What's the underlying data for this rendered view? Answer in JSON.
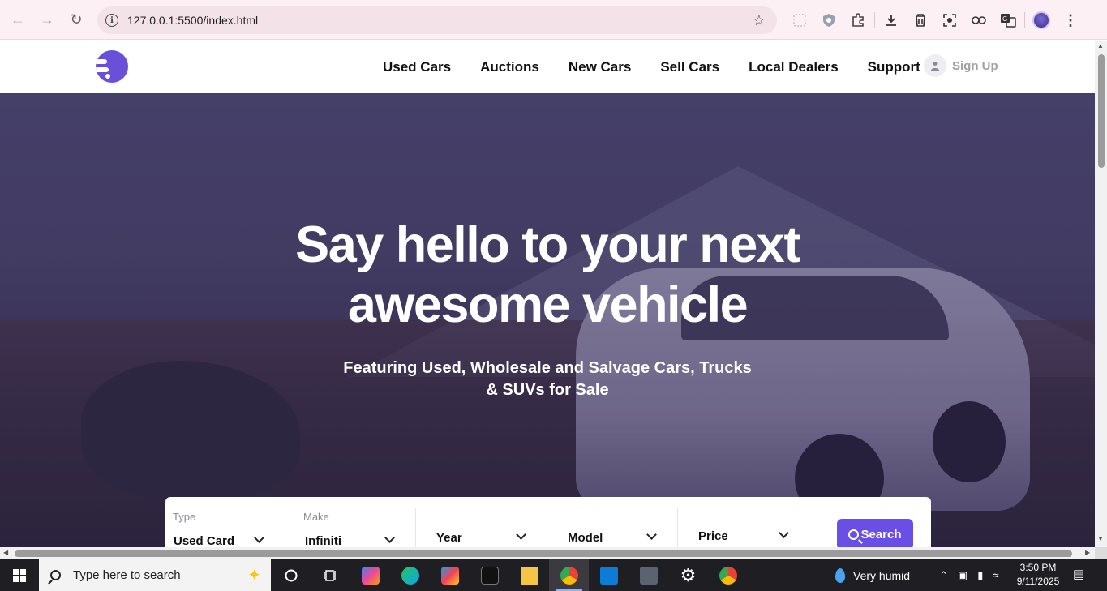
{
  "browser": {
    "url": "127.0.0.1:5500/index.html"
  },
  "site": {
    "nav": [
      "Used Cars",
      "Auctions",
      "New Cars",
      "Sell Cars",
      "Local Dealers",
      "Support"
    ],
    "signup_label": "Sign Up"
  },
  "hero": {
    "title_line1": "Say hello to your next",
    "title_line2": "awesome vehicle",
    "subtitle_line1": "Featuring Used, Wholesale and Salvage Cars, Trucks",
    "subtitle_line2": "& SUVs for Sale"
  },
  "search": {
    "type_label": "Type",
    "type_value": "Used Card",
    "make_label": "Make",
    "make_value": "Infiniti",
    "year_value": "Year",
    "model_value": "Model",
    "price_value": "Price",
    "button_label": "Search"
  },
  "taskbar": {
    "search_placeholder": "Type here to search",
    "weather": "Very humid",
    "time": "3:50 PM",
    "date": "9/11/2025"
  },
  "colors": {
    "brand": "#6a4fd8",
    "search_button": "#6a4fe6"
  }
}
